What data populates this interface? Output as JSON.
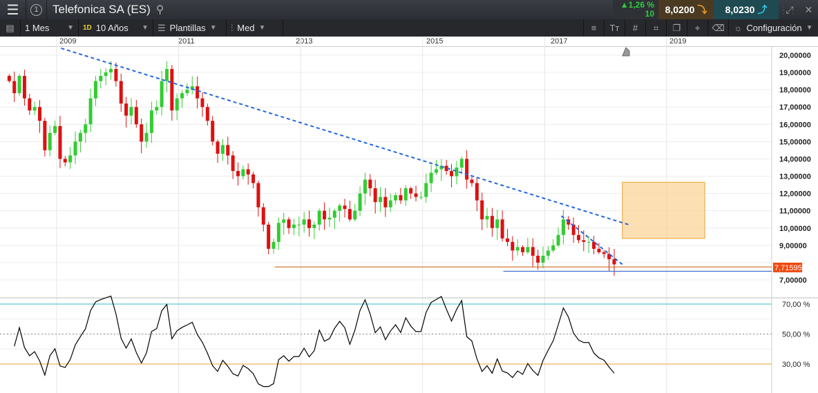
{
  "header": {
    "title": "Telefonica SA (ES)",
    "change_pct": "1,26 %",
    "change_abs": "10",
    "sell_price": "8,0200",
    "buy_price": "8,0230",
    "chart_number": "1"
  },
  "toolbar": {
    "period": "1 Mes",
    "period_badge": "1D",
    "range": "10 Años",
    "templates": "Plantillas",
    "chart_type": "Med",
    "settings": "Configuración"
  },
  "time_axis": [
    "2009",
    "2011",
    "2013",
    "2015",
    "2017",
    "2019"
  ],
  "price_axis": [
    "20,00000",
    "19,00000",
    "18,00000",
    "17,00000",
    "16,00000",
    "15,00000",
    "14,00000",
    "13,00000",
    "12,00000",
    "11,00000",
    "10,00000",
    "9,00000",
    "7,00000"
  ],
  "current_price_label": "7,71595",
  "rsi_axis": [
    "70,00 %",
    "50,00 %",
    "30,00 %"
  ],
  "colors": {
    "up": "#33cc33",
    "down": "#dd1111",
    "trend": "#2266dd",
    "support": "#cc6a1a",
    "support2": "#3366cc",
    "box": "#fbd59a"
  },
  "chart_data": {
    "type": "candlestick",
    "start_year": 2008.2,
    "step": "monthly",
    "closes": [
      18.5,
      17.8,
      18.8,
      17.5,
      16.8,
      17.0,
      16.2,
      14.5,
      15.5,
      15.9,
      14.0,
      13.8,
      14.2,
      15.0,
      15.5,
      16.0,
      17.5,
      18.5,
      18.8,
      19.0,
      19.2,
      18.5,
      17.2,
      16.5,
      17.0,
      16.0,
      15.0,
      15.5,
      16.8,
      17.0,
      18.5,
      19.2,
      16.8,
      17.5,
      17.8,
      18.0,
      18.2,
      17.5,
      17.0,
      16.2,
      15.0,
      14.3,
      14.8,
      14.2,
      13.3,
      13.0,
      13.4,
      13.1,
      12.6,
      11.2,
      10.2,
      8.8,
      9.2,
      10.3,
      10.5,
      10.0,
      10.2,
      10.2,
      10.5,
      10.0,
      10.2,
      11.0,
      10.5,
      10.6,
      11.0,
      11.3,
      11.1,
      10.5,
      11.0,
      12.0,
      12.8,
      12.3,
      11.5,
      11.8,
      11.2,
      11.6,
      11.9,
      11.6,
      12.3,
      12.0,
      11.8,
      11.8,
      12.6,
      13.2,
      13.4,
      13.6,
      13.3,
      13.0,
      13.5,
      14.0,
      12.8,
      12.6,
      11.6,
      10.5,
      10.7,
      10.0,
      10.5,
      9.4,
      9.2,
      8.7,
      8.9,
      8.6,
      8.9,
      8.4,
      8.0,
      8.4,
      8.7,
      9.0,
      9.6,
      10.5,
      10.2,
      9.6,
      9.3,
      9.2,
      9.2,
      8.8,
      8.6,
      8.5,
      8.2,
      7.9
    ],
    "ylim": [
      7,
      20
    ],
    "rsi_ylim": [
      30,
      70
    ],
    "trendlines": [
      {
        "from": [
          2009.05,
          20.4
        ],
        "to": [
          2018.35,
          10.2
        ]
      },
      {
        "from": [
          2017.25,
          10.7
        ],
        "to": [
          2018.25,
          7.9
        ]
      }
    ],
    "support_levels": [
      {
        "value": 7.75,
        "from": 2012.55
      },
      {
        "value": 7.5,
        "from": 2016.3
      }
    ],
    "target_box": {
      "t0": 2018.25,
      "t1": 2019.6,
      "p0": 9.4,
      "p1": 12.65
    }
  }
}
